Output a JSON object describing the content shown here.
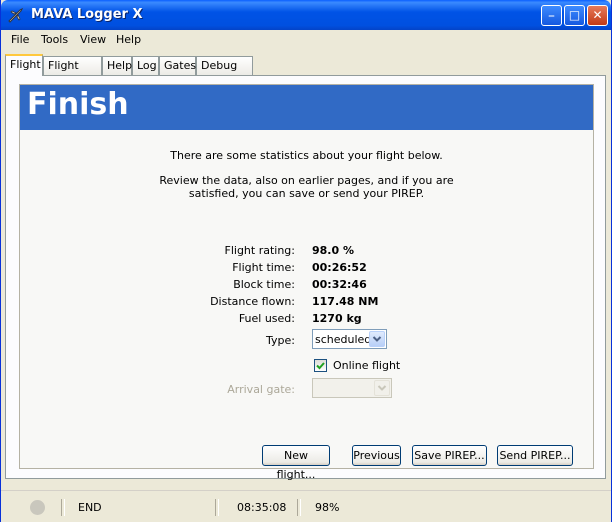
{
  "window": {
    "title": "MAVA Logger X"
  },
  "titlebar_buttons": {
    "minimize": "_",
    "maximize": "□",
    "close": "✕"
  },
  "menu": [
    "File",
    "Tools",
    "View",
    "Help"
  ],
  "tabs": [
    "Flight",
    "Flight info",
    "Help",
    "Log",
    "Gates",
    "Debug log"
  ],
  "active_tab": "Flight",
  "page": {
    "heading": "Finish",
    "intro": "There are some statistics about your flight below.",
    "review_line1": "Review the data, also on earlier pages, and if you are",
    "review_line2": "satisfied, you can save or send your PIREP."
  },
  "stats": [
    {
      "label": "Flight rating:",
      "value": "98.0 %"
    },
    {
      "label": "Flight time:",
      "value": "00:26:52"
    },
    {
      "label": "Block time:",
      "value": "00:32:46"
    },
    {
      "label": "Distance flown:",
      "value": "117.48 NM"
    },
    {
      "label": "Fuel used:",
      "value": "1270 kg"
    }
  ],
  "type_field": {
    "label": "Type:",
    "value": "scheduled"
  },
  "online_flight": {
    "label": "Online flight",
    "checked": true
  },
  "arrival_gate": {
    "label": "Arrival gate:",
    "value": "",
    "disabled": true
  },
  "buttons": {
    "new_flight": "New flight...",
    "previous": "Previous",
    "save_pirep": "Save PIREP...",
    "send_pirep": "Send PIREP..."
  },
  "status": {
    "stage": "END",
    "time": "08:35:08",
    "rating": "98%"
  },
  "colors": {
    "banner": "#316AC5",
    "titlebar": "#0054E3"
  },
  "icons": {
    "app": "airplane-icon",
    "checkmark": "checkmark-icon",
    "dropdown": "chevron-down-icon"
  }
}
